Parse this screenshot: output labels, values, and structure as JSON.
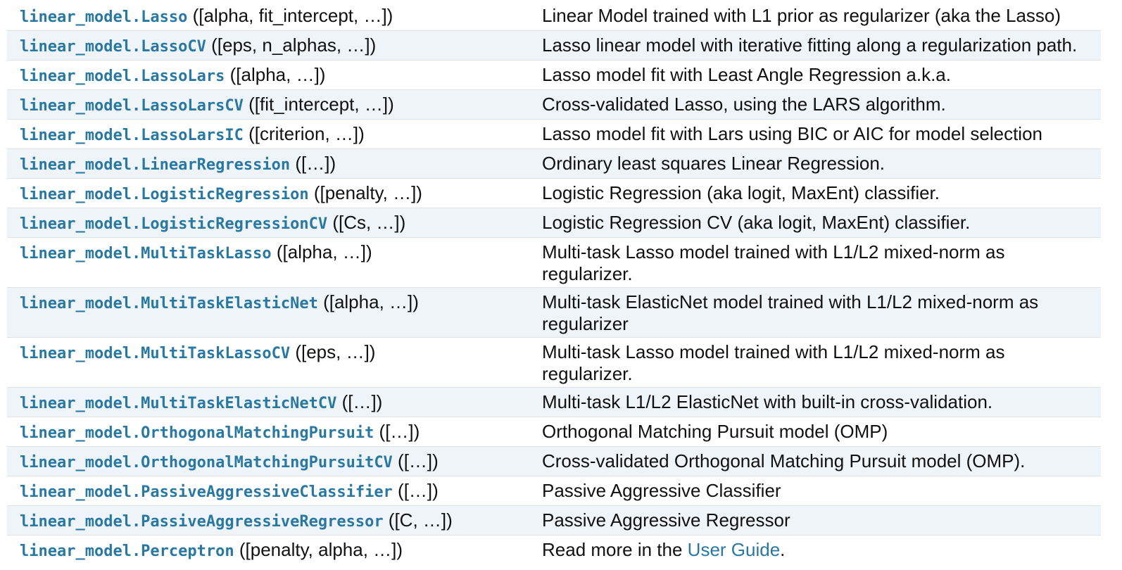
{
  "rows": [
    {
      "name": "linear_model.Lasso",
      "sig": " ([alpha, fit_intercept, …])",
      "desc": "Linear Model trained with L1 prior as regularizer (aka the Lasso)"
    },
    {
      "name": "linear_model.LassoCV",
      "sig": " ([eps, n_alphas, …])",
      "desc": "Lasso linear model with iterative fitting along a regularization path."
    },
    {
      "name": "linear_model.LassoLars",
      "sig": " ([alpha, …])",
      "desc": "Lasso model fit with Least Angle Regression a.k.a."
    },
    {
      "name": "linear_model.LassoLarsCV",
      "sig": " ([fit_intercept, …])",
      "desc": "Cross-validated Lasso, using the LARS algorithm."
    },
    {
      "name": "linear_model.LassoLarsIC",
      "sig": " ([criterion, …])",
      "desc": "Lasso model fit with Lars using BIC or AIC for model selection"
    },
    {
      "name": "linear_model.LinearRegression",
      "sig": " ([…])",
      "desc": "Ordinary least squares Linear Regression."
    },
    {
      "name": "linear_model.LogisticRegression",
      "sig": " ([penalty, …])",
      "desc": "Logistic Regression (aka logit, MaxEnt) classifier."
    },
    {
      "name": "linear_model.LogisticRegressionCV",
      "sig": " ([Cs, …])",
      "desc": "Logistic Regression CV (aka logit, MaxEnt) classifier."
    },
    {
      "name": "linear_model.MultiTaskLasso",
      "sig": " ([alpha, …])",
      "desc": "Multi-task Lasso model trained with L1/L2 mixed-norm as regularizer."
    },
    {
      "name": "linear_model.MultiTaskElasticNet",
      "sig": " ([alpha, …])",
      "desc": "Multi-task ElasticNet model trained with L1/L2 mixed-norm as regularizer"
    },
    {
      "name": "linear_model.MultiTaskLassoCV",
      "sig": " ([eps, …])",
      "desc": "Multi-task Lasso model trained with L1/L2 mixed-norm as regularizer."
    },
    {
      "name": "linear_model.MultiTaskElasticNetCV",
      "sig": " ([…])",
      "desc": "Multi-task L1/L2 ElasticNet with built-in cross-validation."
    },
    {
      "name": "linear_model.OrthogonalMatchingPursuit",
      "sig": " ([…])",
      "desc": "Orthogonal Matching Pursuit model (OMP)"
    },
    {
      "name": "linear_model.OrthogonalMatchingPursuitCV",
      "sig": " ([…])",
      "desc": "Cross-validated Orthogonal Matching Pursuit model (OMP)."
    },
    {
      "name": "linear_model.PassiveAggressiveClassifier",
      "sig": " ([…])",
      "desc": "Passive Aggressive Classifier"
    },
    {
      "name": "linear_model.PassiveAggressiveRegressor",
      "sig": " ([C, …])",
      "desc": "Passive Aggressive Regressor"
    },
    {
      "name": "linear_model.Perceptron",
      "sig": " ([penalty, alpha, …])",
      "desc_prefix": "Read more in the ",
      "desc_link": "User Guide",
      "desc_suffix": "."
    }
  ]
}
